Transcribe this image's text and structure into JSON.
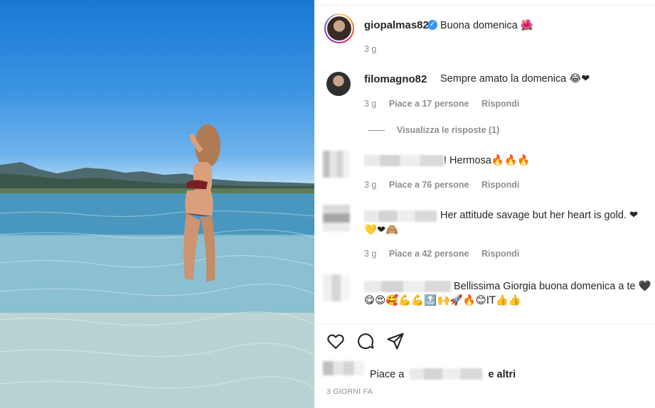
{
  "post": {
    "author": "giopalmas82",
    "caption": "Buona domenica",
    "caption_emoji": "🌺",
    "time": "3 g",
    "verified": true
  },
  "comments": [
    {
      "username": "filomagno82",
      "text": "Sempre amato la domenica",
      "emoji": "😂❤",
      "time": "3 g",
      "likes": "Piace a 17 persone",
      "reply": "Rispondi",
      "view_replies": "Visualizza le risposte (1)"
    },
    {
      "username_hidden": true,
      "text": "! Hermosa",
      "emoji": "🔥🔥🔥",
      "time": "3 g",
      "likes": "Piace a 76 persone",
      "reply": "Rispondi"
    },
    {
      "username_hidden": true,
      "text": "Her attitude savage but her heart is gold.",
      "emoji": "❤",
      "emoji_line2": "💛❤🙈",
      "time": "3 g",
      "likes": "Piace a 42 persone",
      "reply": "Rispondi"
    },
    {
      "username_hidden": true,
      "text": "Bellissima Giorgia buona domenica a te",
      "emoji": "🖤",
      "emoji_line2": "😋😍🥰💪💪🔝🙌🚀🔥😊IT👍👍"
    }
  ],
  "footer": {
    "likes_prefix": "Piace a",
    "likes_suffix": "e altri",
    "date": "3 GIORNI FA"
  },
  "icons": [
    "heart-icon",
    "comment-icon",
    "share-icon",
    "verified-icon"
  ],
  "colors": {
    "verified": "#3897f0",
    "muted": "#8e8e8e",
    "heart": "#e0245e"
  }
}
